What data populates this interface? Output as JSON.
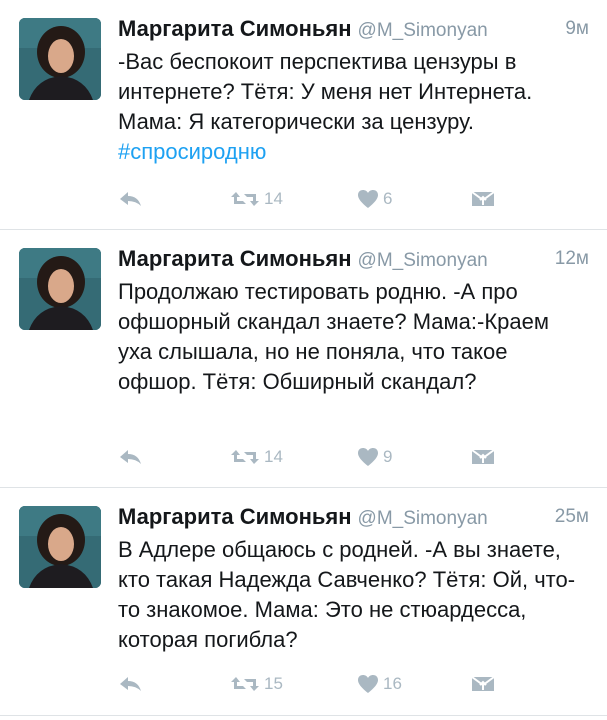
{
  "tweets": [
    {
      "name": "Маргарита Симоньян",
      "handle": "@M_Simonyan",
      "time": "9м",
      "text": "-Вас беспокоит перспектива цензуры в интернете? Тётя: У меня нет Интернета. Мама: Я категорически за цензуру. ",
      "hashtag": "#спросиродню",
      "retweets": "14",
      "likes": "6"
    },
    {
      "name": "Маргарита Симоньян",
      "handle": "@M_Simonyan",
      "time": "12м",
      "text": "Продолжаю тестировать родню. -А про офшорный скандал знаете? Мама:-Краем уха слышала, но не поняла, что такое офшор. Тётя: Обширный скандал?",
      "hashtag": "",
      "retweets": "14",
      "likes": "9"
    },
    {
      "name": "Маргарита Симоньян",
      "handle": "@M_Simonyan",
      "time": "25м",
      "text": "В Адлере общаюсь с родней. -А вы знаете, кто такая Надежда Савченко? Тётя: Ой, что-то знакомое. Мама: Это не стюардесса, которая погибла?",
      "hashtag": "",
      "retweets": "15",
      "likes": "16"
    }
  ],
  "icons": {
    "reply": "reply-icon",
    "retweet": "retweet-icon",
    "like": "heart-icon",
    "message": "direct-message-icon",
    "avatar": "avatar"
  },
  "colors": {
    "text": "#14171a",
    "secondary": "#8899a6",
    "action": "#aab8c2",
    "hashtag": "#1da1f2",
    "divider": "#dfe3e6"
  }
}
